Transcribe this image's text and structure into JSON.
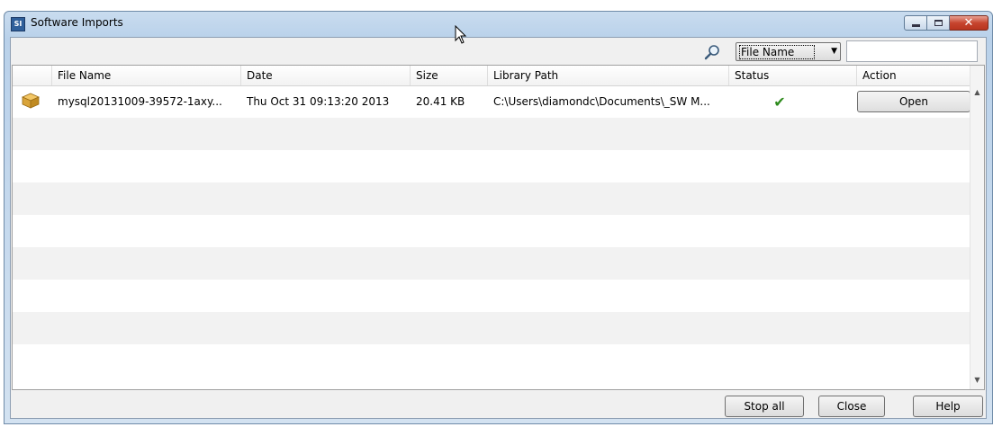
{
  "window": {
    "title": "Software Imports",
    "app_icon_text": "SI",
    "controls": [
      "minimize",
      "maximize",
      "close"
    ]
  },
  "toolbar": {
    "search_icon": "search-icon",
    "filter_field": "File Name",
    "search_value": ""
  },
  "table": {
    "columns": [
      "",
      "File Name",
      "Date",
      "Size",
      "Library Path",
      "Status",
      "Action"
    ],
    "rows": [
      {
        "icon": "package-icon",
        "file_name": "mysql20131009-39572-1axy...",
        "date": "Thu Oct 31 09:13:20 2013",
        "size": "20.41 KB",
        "library_path": "C:\\Users\\diamondc\\Documents\\_SW M...",
        "status": "check-icon",
        "action": "Open"
      }
    ]
  },
  "footer": {
    "stop_all": "Stop all",
    "close": "Close",
    "help": "Help"
  },
  "colors": {
    "titlebar": "#b9d1ea",
    "close_button": "#c7452f",
    "status_ok": "#2e8b1d",
    "stripe": "#f2f2f2"
  }
}
